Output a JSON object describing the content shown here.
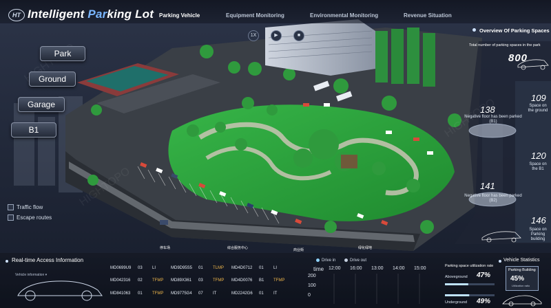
{
  "app": {
    "logo_text": "HT",
    "title_main": "Intelligent ",
    "title_accent": "Par",
    "title_rest": "king Lot"
  },
  "nav": [
    {
      "label": "Parking Vehicle"
    },
    {
      "label": "Equipment Monitoring"
    },
    {
      "label": "Environmental Monitoring"
    },
    {
      "label": "Revenue Situation"
    }
  ],
  "toolbar": [
    {
      "label": "1X",
      "icon": "speed-icon"
    },
    {
      "label": "▶",
      "icon": "play-icon"
    },
    {
      "label": "■",
      "icon": "stop-icon"
    }
  ],
  "side_menu": [
    {
      "label": "Park"
    },
    {
      "label": "Ground"
    },
    {
      "label": "Garage"
    },
    {
      "label": "B1"
    }
  ],
  "layers": [
    {
      "label": "Traffic flow"
    },
    {
      "label": "Escape routes"
    }
  ],
  "map_labels": [
    "停车场",
    "综合服务中心",
    "商业街",
    "绿化绿地"
  ],
  "overview": {
    "title": "Overview Of Parking Spaces",
    "total_label": "Total number of parking spaces in the park",
    "total_value": "800",
    "floors": [
      {
        "value": "138",
        "caption": "Negative floor has been parked (B1)"
      },
      {
        "value": "109",
        "caption": "Space on the ground"
      },
      {
        "value": "120",
        "caption": "Space on the B1"
      },
      {
        "value": "141",
        "caption": "Negative floor has been parked (B2)"
      },
      {
        "value": "146",
        "caption": "Space on Parking building"
      }
    ]
  },
  "access": {
    "title": "Real-time Access Information",
    "vehicle_info_label": "Vehicle information",
    "rows": [
      [
        {
          "plate": "MD0699U9",
          "lane": "03",
          "type": "LI"
        },
        {
          "plate": "MD9D95S5",
          "lane": "01",
          "type": "TLMP"
        },
        {
          "plate": "MD4D0712",
          "lane": "01",
          "type": "LI"
        }
      ],
      [
        {
          "plate": "MD042316",
          "lane": "02",
          "type": "TFMP"
        },
        {
          "plate": "MD89X361",
          "lane": "03",
          "type": "TFMP"
        },
        {
          "plate": "MD4D0076",
          "lane": "B1",
          "type": "TFMP"
        }
      ],
      [
        {
          "plate": "MD841063",
          "lane": "01",
          "type": "TFMP"
        },
        {
          "plate": "MD9775G4",
          "lane": "07",
          "type": "IT"
        },
        {
          "plate": "MD2242G6",
          "lane": "01",
          "type": "IT"
        }
      ]
    ]
  },
  "traffic_chart": {
    "legend_in": "Drive in",
    "legend_out": "Drive out",
    "x_label": "time",
    "times": [
      "12:00",
      "16:00",
      "13:00",
      "14:00",
      "15:00"
    ],
    "y_ticks": [
      "200",
      "100",
      "0"
    ],
    "colors": {
      "in": "#8fd4ff",
      "out": "#c5cfe0"
    }
  },
  "utilization": {
    "title": "Parking space utilization rate",
    "rows": [
      {
        "label": "Aboveground",
        "value": "47%"
      },
      {
        "label": "Underground",
        "value": "49%"
      }
    ]
  },
  "vehicle_statistics": {
    "title": "Vehicle Statistics",
    "card_title": "Parking Building",
    "card_value": "45%",
    "card_sub": "Utilization ratio"
  }
}
